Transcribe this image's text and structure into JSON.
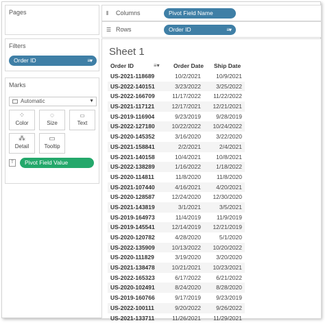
{
  "pages": {
    "title": "Pages"
  },
  "filters": {
    "title": "Filters",
    "pill": "Order ID"
  },
  "marks": {
    "title": "Marks",
    "type": "Automatic",
    "buttons": [
      {
        "label": "Color",
        "icon": "color-icon"
      },
      {
        "label": "Size",
        "icon": "size-icon"
      },
      {
        "label": "Text",
        "icon": "text-icon"
      },
      {
        "label": "Detail",
        "icon": "detail-icon"
      },
      {
        "label": "Tooltip",
        "icon": "tooltip-icon"
      }
    ],
    "field_pill": "Pivot Field Value"
  },
  "columns": {
    "label": "Columns",
    "pill": "Pivot Field Name"
  },
  "rows": {
    "label": "Rows",
    "pill": "Order ID"
  },
  "sheet": {
    "title": "Sheet 1",
    "headers": {
      "order_id": "Order ID",
      "order_date": "Order Date",
      "ship_date": "Ship Date"
    },
    "rows": [
      [
        "US-2021-118689",
        "10/2/2021",
        "10/9/2021"
      ],
      [
        "US-2022-140151",
        "3/23/2022",
        "3/25/2022"
      ],
      [
        "US-2022-166709",
        "11/17/2022",
        "11/22/2022"
      ],
      [
        "US-2021-117121",
        "12/17/2021",
        "12/21/2021"
      ],
      [
        "US-2019-116904",
        "9/23/2019",
        "9/28/2019"
      ],
      [
        "US-2022-127180",
        "10/22/2022",
        "10/24/2022"
      ],
      [
        "US-2020-145352",
        "3/16/2020",
        "3/22/2020"
      ],
      [
        "US-2021-158841",
        "2/2/2021",
        "2/4/2021"
      ],
      [
        "US-2021-140158",
        "10/4/2021",
        "10/8/2021"
      ],
      [
        "US-2022-138289",
        "1/16/2022",
        "1/18/2022"
      ],
      [
        "US-2020-114811",
        "11/8/2020",
        "11/8/2020"
      ],
      [
        "US-2021-107440",
        "4/16/2021",
        "4/20/2021"
      ],
      [
        "US-2020-128587",
        "12/24/2020",
        "12/30/2020"
      ],
      [
        "US-2021-143819",
        "3/1/2021",
        "3/5/2021"
      ],
      [
        "US-2019-164973",
        "11/4/2019",
        "11/9/2019"
      ],
      [
        "US-2019-145541",
        "12/14/2019",
        "12/21/2019"
      ],
      [
        "US-2020-120782",
        "4/28/2020",
        "5/1/2020"
      ],
      [
        "US-2022-135909",
        "10/13/2022",
        "10/20/2022"
      ],
      [
        "US-2020-111829",
        "3/19/2020",
        "3/20/2020"
      ],
      [
        "US-2021-138478",
        "10/21/2021",
        "10/23/2021"
      ],
      [
        "US-2022-165323",
        "6/17/2022",
        "6/21/2022"
      ],
      [
        "US-2020-102491",
        "8/24/2020",
        "8/28/2020"
      ],
      [
        "US-2019-160766",
        "9/17/2019",
        "9/23/2019"
      ],
      [
        "US-2022-100111",
        "9/20/2022",
        "9/26/2022"
      ],
      [
        "US-2021-133711",
        "11/26/2021",
        "11/29/2021"
      ]
    ]
  },
  "colors": {
    "pill_blue": "#3f7fa6",
    "pill_green": "#24a86b"
  }
}
